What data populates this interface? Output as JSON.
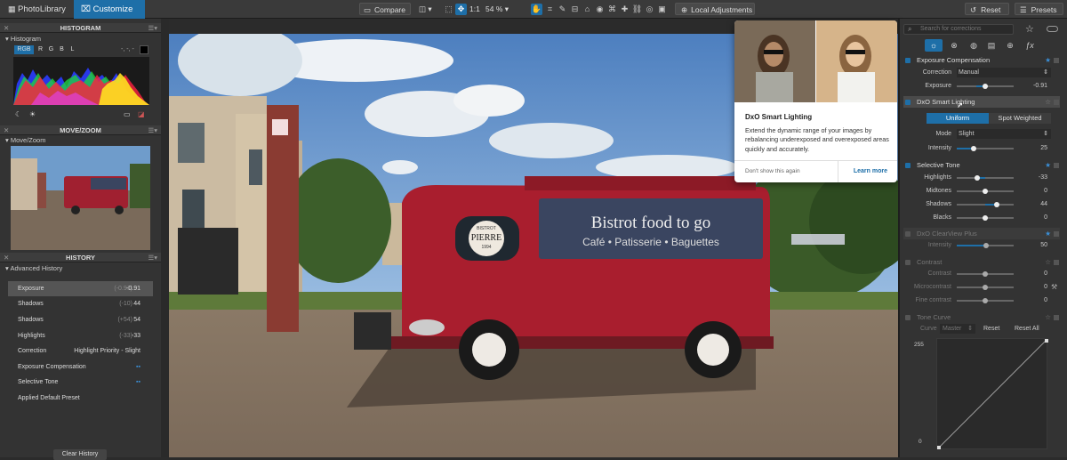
{
  "tabs": {
    "library": "PhotoLibrary",
    "customize": "Customize"
  },
  "toolbar": {
    "compare": "Compare",
    "one_to_one": "1:1",
    "zoom": "54 %",
    "local_adjustments": "Local Adjustments",
    "reset": "Reset",
    "presets": "Presets"
  },
  "left": {
    "histogram_title": "HISTOGRAM",
    "histogram_sub": "Histogram",
    "channels": [
      "RGB",
      "R",
      "G",
      "B",
      "L"
    ],
    "hist_value": "-, -, -",
    "movezoom_title": "MOVE/ZOOM",
    "movezoom_sub": "Move/Zoom",
    "history_title": "HISTORY",
    "history_sub": "Advanced History",
    "history": [
      {
        "label": "Exposure",
        "old": "(-0.91)",
        "value": "-0.91"
      },
      {
        "label": "Shadows",
        "old": "(-10)",
        "value": "44"
      },
      {
        "label": "Shadows",
        "old": "(+54)",
        "value": "54"
      },
      {
        "label": "Highlights",
        "old": "(-33)",
        "value": "-33"
      },
      {
        "label": "Correction",
        "old": "",
        "value": "Highlight Priority - Slight"
      },
      {
        "label": "Exposure Compensation",
        "old": "",
        "value": ""
      },
      {
        "label": "Selective Tone",
        "old": "",
        "value": ""
      },
      {
        "label": "Applied Default Preset",
        "old": "",
        "value": ""
      }
    ],
    "clear_history": "Clear History"
  },
  "photo": {
    "sign_line1": "Bistrot food to go",
    "sign_line2": "Café • Patisserie • Baguettes",
    "badge_top": "BISTROT",
    "badge_mid": "PIERRE",
    "badge_bot": "1994"
  },
  "popup": {
    "title": "DxO Smart Lighting",
    "body": "Extend the dynamic range of your images by rebalancing underexposed and overexposed areas quickly and accurately.",
    "dont_show": "Don't show this again",
    "learn_more": "Learn more"
  },
  "right": {
    "search_placeholder": "Search for corrections",
    "exposure_comp": "Exposure Compensation",
    "correction_label": "Correction",
    "correction_value": "Manual",
    "exposure_label": "Exposure",
    "exposure_value": "-0.91",
    "smart_lighting": "DxO Smart Lighting",
    "uniform": "Uniform",
    "spot": "Spot Weighted",
    "mode_label": "Mode",
    "mode_value": "Slight",
    "intensity_label": "Intensity",
    "intensity_value": "25",
    "selective_tone": "Selective Tone",
    "highlights_label": "Highlights",
    "highlights_value": "-33",
    "midtones_label": "Midtones",
    "midtones_value": "0",
    "shadows_label": "Shadows",
    "shadows_value": "44",
    "blacks_label": "Blacks",
    "blacks_value": "0",
    "clearview": "DxO ClearView Plus",
    "cv_intensity_label": "Intensity",
    "cv_intensity_value": "50",
    "contrast_sec": "Contrast",
    "contrast_label": "Contrast",
    "contrast_value": "0",
    "micro_label": "Microcontrast",
    "micro_value": "0",
    "fine_label": "Fine contrast",
    "fine_value": "0",
    "tone_curve": "Tone Curve",
    "curve_label": "Curve",
    "curve_value": "Master",
    "curve_reset": "Reset",
    "curve_reset_all": "Reset All",
    "curve_255": "255",
    "curve_0": "0"
  }
}
